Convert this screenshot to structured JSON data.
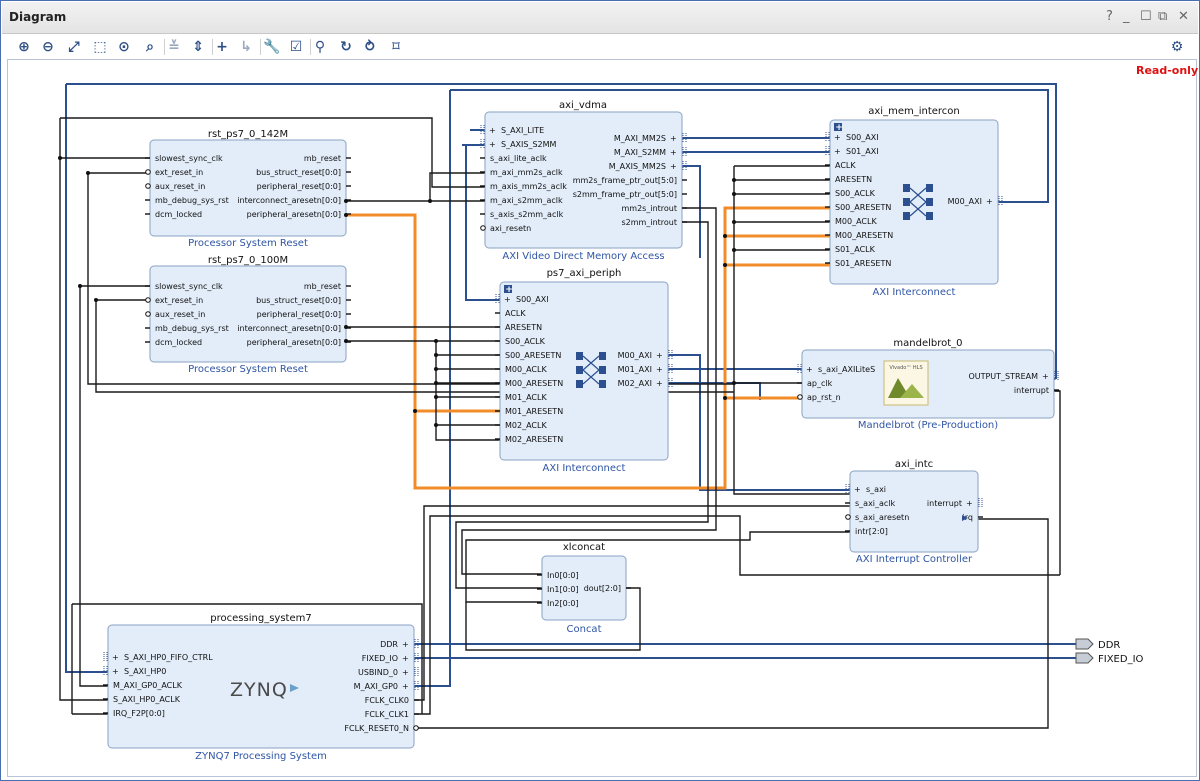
{
  "window": {
    "title": "Diagram",
    "controls": [
      "?",
      "_",
      "☐",
      "⧉",
      "✕"
    ],
    "read_only_label": "Read-only"
  },
  "toolbar": {
    "buttons": [
      {
        "icon": "zoom-in-icon",
        "glyph": "⊕",
        "enabled": true
      },
      {
        "icon": "zoom-out-icon",
        "glyph": "⊖",
        "enabled": true
      },
      {
        "icon": "zoom-fit-icon",
        "glyph": "⤢",
        "enabled": true
      },
      {
        "icon": "zoom-area-icon",
        "glyph": "⬚",
        "enabled": true
      },
      {
        "icon": "fit-selection-icon",
        "glyph": "⊙",
        "enabled": true
      },
      {
        "icon": "search-icon",
        "glyph": "⌕",
        "enabled": true
      },
      {
        "icon": "collapse-all-icon",
        "glyph": "≚",
        "enabled": false
      },
      {
        "icon": "expand-all-icon",
        "glyph": "⇕",
        "enabled": true
      },
      {
        "icon": "add-ip-icon",
        "glyph": "+",
        "enabled": true
      },
      {
        "icon": "make-connection-icon",
        "glyph": "↳",
        "enabled": false
      },
      {
        "icon": "wrench-icon",
        "glyph": "🔧",
        "enabled": false
      },
      {
        "icon": "validate-design-icon",
        "glyph": "☑",
        "enabled": true
      },
      {
        "icon": "autoconnect-icon",
        "glyph": "⚲",
        "enabled": true
      },
      {
        "icon": "regenerate-layout-icon",
        "glyph": "↻",
        "enabled": true
      },
      {
        "icon": "optimize-routing-icon",
        "glyph": "⥁",
        "enabled": true
      },
      {
        "icon": "pin-icon",
        "glyph": "⌑",
        "enabled": true
      }
    ],
    "settings_icon": "gear-icon"
  },
  "colors": {
    "block_fill": "#e3edf9",
    "block_border": "#8aa2c4",
    "bus": "#2c4f8f",
    "net": "#1a1a1a",
    "highlight": "#f28c28",
    "link": "#2f55a4",
    "title_text": "#111111"
  },
  "blocks": [
    {
      "id": "rst1",
      "instance": "rst_ps7_0_142M",
      "subtitle": "Processor System Reset",
      "left": [
        "slowest_sync_clk",
        "ext_reset_in",
        "aux_reset_in",
        "mb_debug_sys_rst",
        "dcm_locked"
      ],
      "right": [
        "mb_reset",
        "bus_struct_reset[0:0]",
        "peripheral_reset[0:0]",
        "interconnect_aresetn[0:0]",
        "peripheral_aresetn[0:0]"
      ]
    },
    {
      "id": "rst2",
      "instance": "rst_ps7_0_100M",
      "subtitle": "Processor System Reset",
      "left": [
        "slowest_sync_clk",
        "ext_reset_in",
        "aux_reset_in",
        "mb_debug_sys_rst",
        "dcm_locked"
      ],
      "right": [
        "mb_reset",
        "bus_struct_reset[0:0]",
        "peripheral_reset[0:0]",
        "interconnect_aresetn[0:0]",
        "peripheral_aresetn[0:0]"
      ]
    },
    {
      "id": "vdma",
      "instance": "axi_vdma",
      "subtitle": "AXI Video Direct Memory Access",
      "left": [
        "S_AXI_LITE",
        "S_AXIS_S2MM",
        "s_axi_lite_aclk",
        "m_axi_mm2s_aclk",
        "m_axis_mm2s_aclk",
        "m_axi_s2mm_aclk",
        "s_axis_s2mm_aclk",
        "axi_resetn"
      ],
      "right": [
        "M_AXI_MM2S",
        "M_AXI_S2MM",
        "M_AXIS_MM2S",
        "mm2s_frame_ptr_out[5:0]",
        "s2mm_frame_ptr_out[5:0]",
        "mm2s_introut",
        "s2mm_introut"
      ]
    },
    {
      "id": "periph",
      "instance": "ps7_axi_periph",
      "subtitle": "AXI Interconnect",
      "left": [
        "S00_AXI",
        "ACLK",
        "ARESETN",
        "S00_ACLK",
        "S00_ARESETN",
        "M00_ACLK",
        "M00_ARESETN",
        "M01_ACLK",
        "M01_ARESETN",
        "M02_ACLK",
        "M02_ARESETN"
      ],
      "right": [
        "M00_AXI",
        "M01_AXI",
        "M02_AXI"
      ]
    },
    {
      "id": "memic",
      "instance": "axi_mem_intercon",
      "subtitle": "AXI Interconnect",
      "left": [
        "S00_AXI",
        "S01_AXI",
        "ACLK",
        "ARESETN",
        "S00_ACLK",
        "S00_ARESETN",
        "M00_ACLK",
        "M00_ARESETN",
        "S01_ACLK",
        "S01_ARESETN"
      ],
      "right": [
        "M00_AXI"
      ]
    },
    {
      "id": "mandel",
      "instance": "mandelbrot_0",
      "subtitle": "Mandelbrot (Pre-Production)",
      "left": [
        "s_axi_AXILiteS",
        "ap_clk",
        "ap_rst_n"
      ],
      "right": [
        "OUTPUT_STREAM",
        "interrupt"
      ],
      "logo_text": "Vivado™ HLS"
    },
    {
      "id": "intc",
      "instance": "axi_intc",
      "subtitle": "AXI Interrupt Controller",
      "left": [
        "s_axi",
        "s_axi_aclk",
        "s_axi_aresetn",
        "intr[2:0]"
      ],
      "right": [
        "interrupt",
        "irq"
      ]
    },
    {
      "id": "concat",
      "instance": "xlconcat",
      "subtitle": "Concat",
      "left": [
        "In0[0:0]",
        "In1[0:0]",
        "In2[0:0]"
      ],
      "right": [
        "dout[2:0]"
      ]
    },
    {
      "id": "ps7",
      "instance": "processing_system7",
      "subtitle": "ZYNQ7 Processing System",
      "left": [
        "S_AXI_HP0_FIFO_CTRL",
        "S_AXI_HP0",
        "M_AXI_GP0_ACLK",
        "S_AXI_HP0_ACLK",
        "IRQ_F2P[0:0]"
      ],
      "right": [
        "DDR",
        "FIXED_IO",
        "USBIND_0",
        "M_AXI_GP0",
        "FCLK_CLK0",
        "FCLK_CLK1",
        "FCLK_RESET0_N"
      ],
      "logo_text": "ZYNQ"
    }
  ],
  "external_ports": [
    "DDR",
    "FIXED_IO"
  ]
}
